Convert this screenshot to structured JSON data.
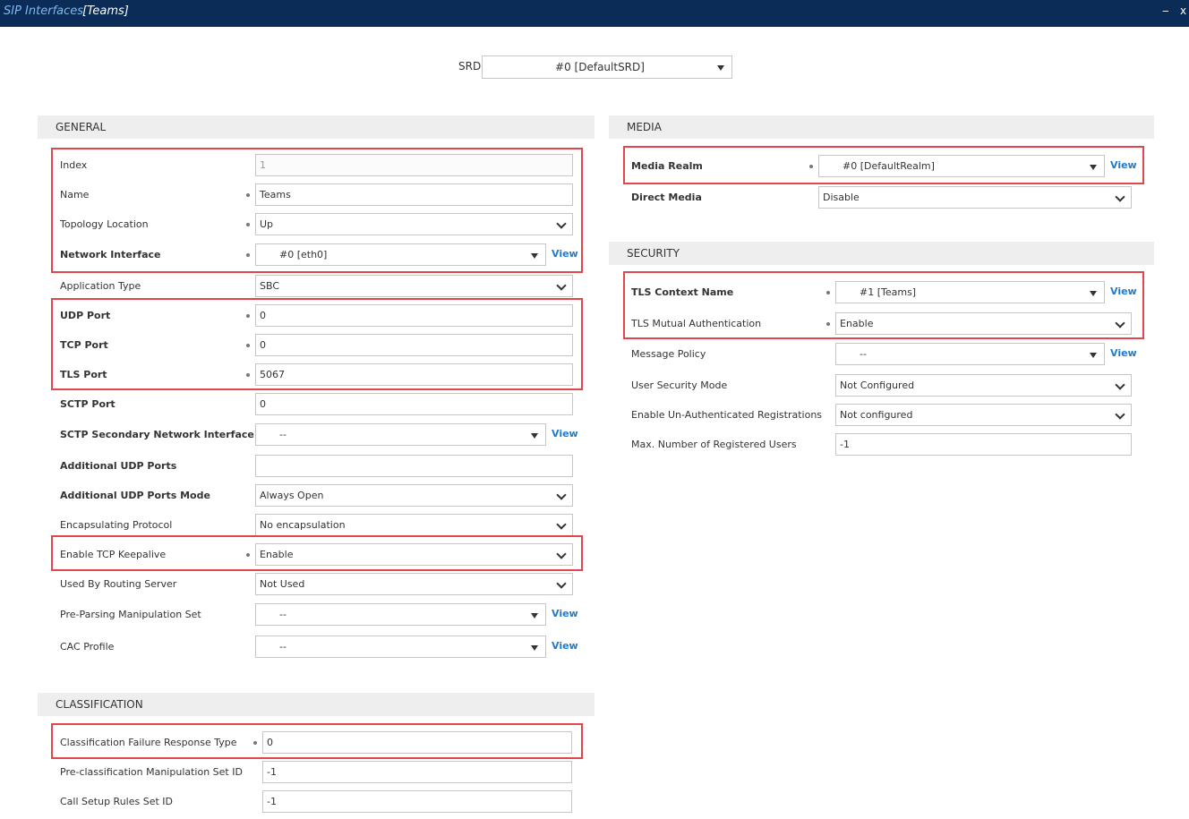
{
  "window": {
    "title": "SIP Interfaces",
    "subtitle": "[Teams]",
    "minimize_glyph": "‒",
    "close_glyph": "x"
  },
  "srd": {
    "label": "SRD",
    "value": "#0 [DefaultSRD]"
  },
  "general": {
    "header": "GENERAL",
    "fields": {
      "index": {
        "label": "Index",
        "value": "1"
      },
      "name": {
        "label": "Name",
        "value": "Teams"
      },
      "topology_location": {
        "label": "Topology Location",
        "value": "Up"
      },
      "network_interface": {
        "label": "Network Interface",
        "value": "#0 [eth0]"
      },
      "application_type": {
        "label": "Application Type",
        "value": "SBC"
      },
      "udp_port": {
        "label": "UDP Port",
        "value": "0"
      },
      "tcp_port": {
        "label": "TCP Port",
        "value": "0"
      },
      "tls_port": {
        "label": "TLS Port",
        "value": "5067"
      },
      "sctp_port": {
        "label": "SCTP Port",
        "value": "0"
      },
      "sctp_secondary": {
        "label": "SCTP Secondary Network Interface",
        "value": "--"
      },
      "additional_udp_ports": {
        "label": "Additional UDP Ports",
        "value": ""
      },
      "additional_udp_ports_mode": {
        "label": "Additional UDP Ports Mode",
        "value": "Always Open"
      },
      "encapsulating_protocol": {
        "label": "Encapsulating Protocol",
        "value": "No encapsulation"
      },
      "tcp_keepalive": {
        "label": "Enable TCP Keepalive",
        "value": "Enable"
      },
      "used_by_routing_server": {
        "label": "Used By Routing Server",
        "value": "Not Used"
      },
      "pre_parsing_manipulation": {
        "label": "Pre-Parsing Manipulation Set",
        "value": "--"
      },
      "cac_profile": {
        "label": "CAC Profile",
        "value": "--"
      }
    }
  },
  "classification": {
    "header": "CLASSIFICATION",
    "fields": {
      "failure_response": {
        "label": "Classification Failure Response Type",
        "value": "0"
      },
      "pre_classification": {
        "label": "Pre-classification Manipulation Set ID",
        "value": "-1"
      },
      "call_setup_rules": {
        "label": "Call Setup Rules Set ID",
        "value": "-1"
      }
    }
  },
  "media": {
    "header": "MEDIA",
    "fields": {
      "media_realm": {
        "label": "Media Realm",
        "value": "#0 [DefaultRealm]"
      },
      "direct_media": {
        "label": "Direct Media",
        "value": "Disable"
      }
    }
  },
  "security": {
    "header": "SECURITY",
    "fields": {
      "tls_context": {
        "label": "TLS Context Name",
        "value": "#1 [Teams]"
      },
      "tls_mutual_auth": {
        "label": "TLS Mutual Authentication",
        "value": "Enable"
      },
      "message_policy": {
        "label": "Message Policy",
        "value": "--"
      },
      "user_security_mode": {
        "label": "User Security Mode",
        "value": "Not Configured"
      },
      "unauth_registrations": {
        "label": "Enable Un-Authenticated Registrations",
        "value": "Not configured"
      },
      "max_registered_users": {
        "label": "Max. Number of Registered Users",
        "value": "-1"
      }
    }
  },
  "view_link_label": "View",
  "colors": {
    "titlebar": "#0b2c57",
    "title_accent": "#7fb8ee",
    "highlight": "#e0474c",
    "link": "#1f7bd0",
    "section_bg": "#eeeeee"
  }
}
